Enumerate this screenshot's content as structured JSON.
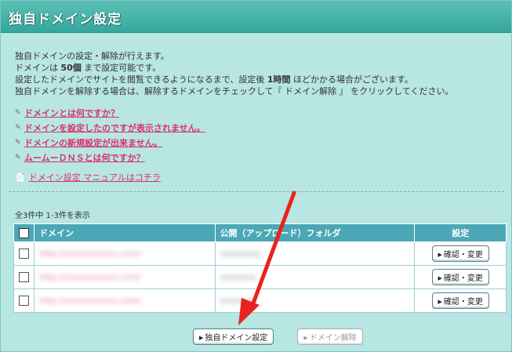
{
  "header": {
    "title": "独自ドメイン設定"
  },
  "description": {
    "line1": "独自ドメインの設定・解除が行えます。",
    "line2_pre": "ドメインは ",
    "line2_bold": "50個",
    "line2_post": " まで設定可能です。",
    "line3_pre": "設定したドメインでサイトを閲覧できるようになるまで、設定後 ",
    "line3_bold": "1時間",
    "line3_post": " ほどかかる場合がございます。",
    "line4": "独自ドメインを解除する場合は、解除するドメインをチェックして『 ドメイン解除 』 をクリックしてください。"
  },
  "help_links": [
    {
      "label": "ドメインとは何ですか？"
    },
    {
      "label": "ドメインを設定したのですが表示されません。"
    },
    {
      "label": "ドメインの新規設定が出来ません。"
    },
    {
      "label": "ムームーＤＮＳとは何ですか？"
    }
  ],
  "manual_link": "ドメイン設定 マニュアルはコチラ",
  "count_text": "全3件中 1-3件を表示",
  "table": {
    "headers": {
      "domain": "ドメイン",
      "folder": "公開（アップロード）フォルダ",
      "settings": "設定"
    },
    "rows": [
      {
        "domain": "http://xxxxxxxxxx.com/",
        "folder": "xxxxxxxx",
        "button": "確認・変更"
      },
      {
        "domain": "http://xxxxxxxxxx.com/",
        "folder": "xxxxxxx",
        "button": "確認・変更"
      },
      {
        "domain": "http://xxxxxxxxxx.com/",
        "folder": "xxxxxxx",
        "button": "確認・変更"
      }
    ]
  },
  "buttons": {
    "add": "独自ドメイン設定",
    "remove": "ドメイン解除"
  },
  "colors": {
    "accent": "#35a79c",
    "table_header": "#4ba7b5",
    "link": "#d8326a",
    "annotation_arrow": "#e8231e"
  }
}
